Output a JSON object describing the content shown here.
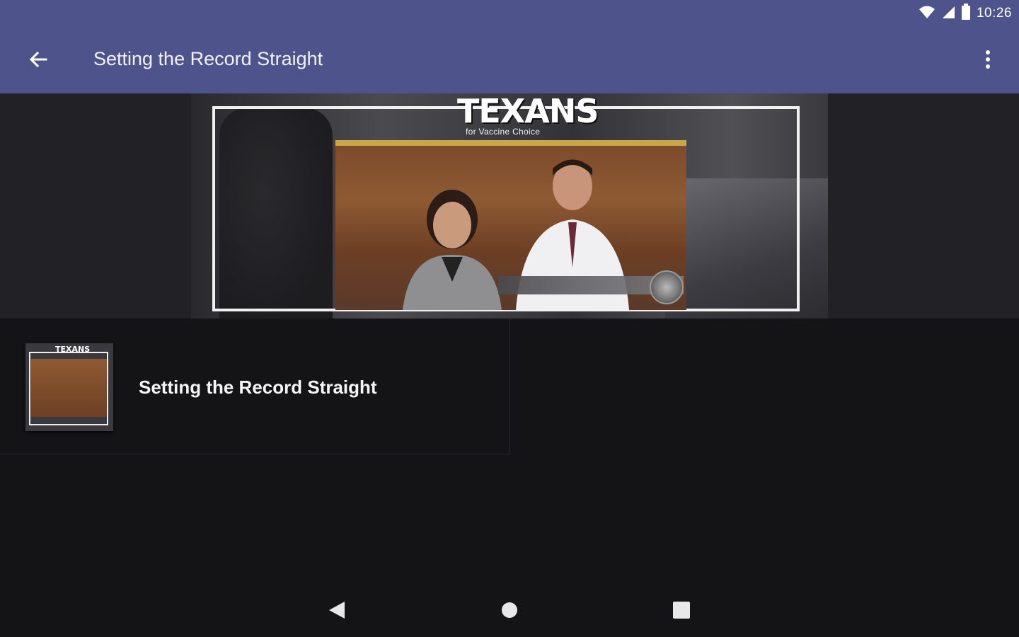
{
  "status_bar": {
    "time": "10:26",
    "icons": [
      "wifi-icon",
      "signal-icon",
      "battery-icon"
    ]
  },
  "app_bar": {
    "title": "Setting the Record Straight",
    "back_icon": "arrow-back-icon",
    "menu_icon": "more-vert-icon"
  },
  "player": {
    "logo_title": "TEXANS",
    "logo_subtitle": "for Vaccine Choice"
  },
  "list": {
    "items": [
      {
        "title": "Setting the Record Straight",
        "thumb_logo": "TEXANS"
      }
    ]
  },
  "nav": {
    "icons": [
      "nav-back-icon",
      "nav-home-icon",
      "nav-recents-icon"
    ]
  },
  "colors": {
    "app_bar": "#4e548b",
    "background": "#141417",
    "player_background": "#222226"
  }
}
